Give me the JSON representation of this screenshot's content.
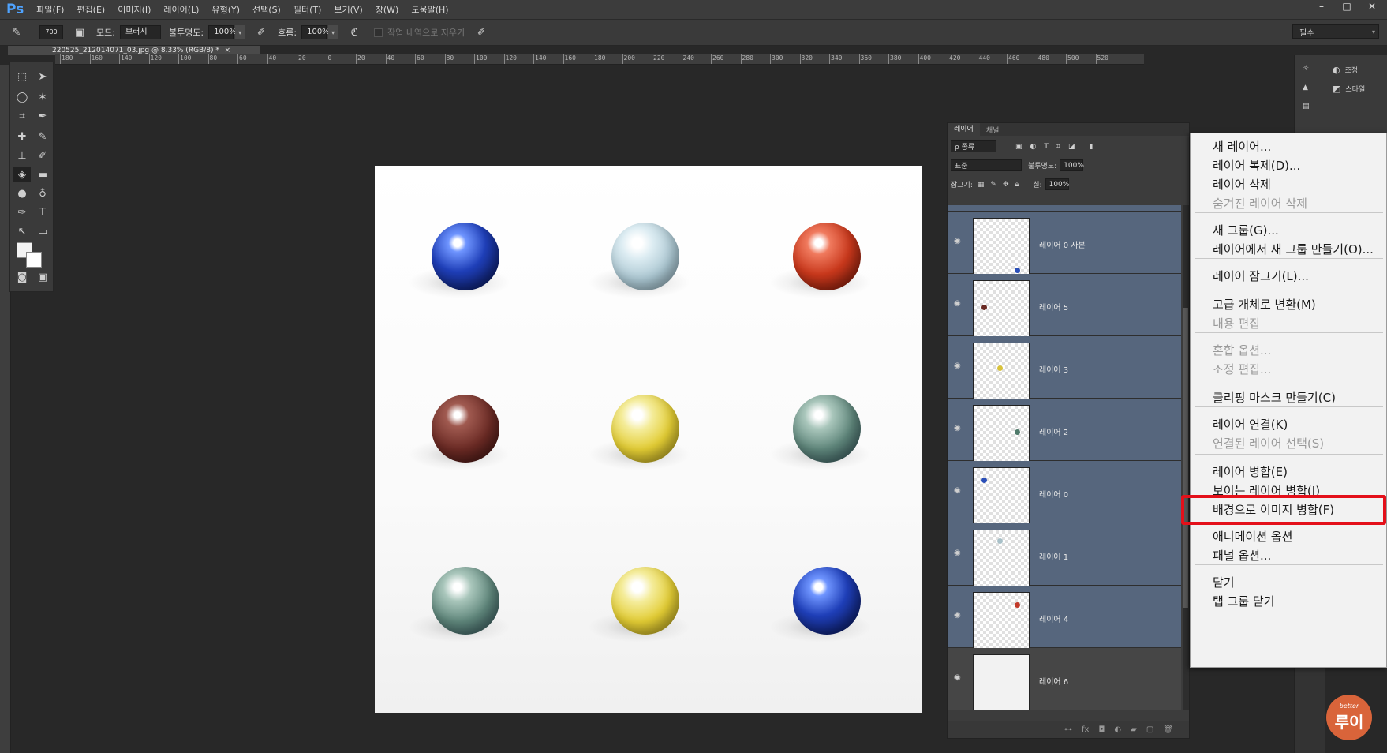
{
  "app": {
    "logo": "Ps"
  },
  "menubar": {
    "items": [
      "파일(F)",
      "편집(E)",
      "이미지(I)",
      "레이어(L)",
      "유형(Y)",
      "선택(S)",
      "필터(T)",
      "보기(V)",
      "창(W)",
      "도움말(H)"
    ],
    "window_buttons": [
      "–",
      "□",
      "✕"
    ]
  },
  "options_bar": {
    "brush_size": "700",
    "mode_label": "모드:",
    "mode_value": "브러시",
    "opacity_label": "불투명도:",
    "opacity_value": "100%",
    "flow_label": "흐름:",
    "flow_value": "100%",
    "erase_history_label": "작업 내역으로 지우기",
    "workspace": "필수"
  },
  "document": {
    "tab_title": "220525_212014071_03.jpg @ 8.33% (RGB/8) *",
    "close": "×"
  },
  "ruler": {
    "labels": [
      "180",
      "160",
      "140",
      "120",
      "100",
      "80",
      "60",
      "40",
      "20",
      "0",
      "20",
      "40",
      "60",
      "80",
      "100",
      "120",
      "140",
      "160",
      "180",
      "200",
      "220",
      "240",
      "260",
      "280",
      "300",
      "320",
      "340",
      "360",
      "380",
      "400",
      "420",
      "440",
      "460",
      "480",
      "500",
      "520"
    ]
  },
  "right_dock": {
    "items": [
      {
        "icon": "adjust-icon",
        "label": "조정"
      },
      {
        "icon": "style-icon",
        "label": "스타일"
      }
    ]
  },
  "layers_panel": {
    "tabs": [
      "레이어",
      "채널"
    ],
    "filter_label": "ρ 종류",
    "blend_mode": "표준",
    "opacity_label": "불투명도:",
    "opacity_value": "100%",
    "lock_label": "잠그기:",
    "fill_label": "칠:",
    "fill_value": "100%",
    "layers": [
      {
        "name": "레이어 0 사본",
        "selected": true,
        "dot_color": "#2a4fb8"
      },
      {
        "name": "레이어 5",
        "selected": true,
        "dot_color": "#6a2a24"
      },
      {
        "name": "레이어 3",
        "selected": true,
        "dot_color": "#d8c23a"
      },
      {
        "name": "레이어 2",
        "selected": true,
        "dot_color": "#4f7a6a"
      },
      {
        "name": "레이어 0",
        "selected": true,
        "dot_color": "#2a4fb8"
      },
      {
        "name": "레이어 1",
        "selected": true,
        "dot_color": "#a8c0c8"
      },
      {
        "name": "레이어 4",
        "selected": true,
        "dot_color": "#c23a2a"
      },
      {
        "name": "레이어 6",
        "selected": false,
        "dot_color": ""
      }
    ]
  },
  "context_menu": {
    "items": [
      {
        "label": "새 레이어...",
        "disabled": false
      },
      {
        "label": "레이어 복제(D)...",
        "disabled": false
      },
      {
        "label": "레이어 삭제",
        "disabled": false
      },
      {
        "label": "숨겨진 레이어 삭제",
        "disabled": true
      },
      {
        "label": "새 그룹(G)...",
        "disabled": false
      },
      {
        "label": "레이어에서 새 그룹 만들기(O)...",
        "disabled": false
      },
      {
        "label": "레이어 잠그기(L)...",
        "disabled": false
      },
      {
        "label": "고급 개체로 변환(M)",
        "disabled": false
      },
      {
        "label": "내용 편집",
        "disabled": true
      },
      {
        "label": "혼합 옵션...",
        "disabled": true
      },
      {
        "label": "조정 편집...",
        "disabled": true
      },
      {
        "label": "클리핑 마스크 만들기(C)",
        "disabled": false
      },
      {
        "label": "레이어 연결(K)",
        "disabled": false
      },
      {
        "label": "연결된 레이어 선택(S)",
        "disabled": true
      },
      {
        "label": "레이어 병합(E)",
        "disabled": false,
        "highlighted": true
      },
      {
        "label": "보이는 레이어 병합(I)",
        "disabled": false
      },
      {
        "label": "배경으로 이미지 병합(F)",
        "disabled": false
      },
      {
        "label": "애니메이션 옵션",
        "disabled": false
      },
      {
        "label": "패널 옵션...",
        "disabled": false
      },
      {
        "label": "닫기",
        "disabled": false
      },
      {
        "label": "탭 그룹 닫기",
        "disabled": false
      }
    ],
    "highlight_color": "#e4101a"
  },
  "canvas": {
    "marbles": [
      {
        "color": "blue-white swirl"
      },
      {
        "color": "pale aqua speckled"
      },
      {
        "color": "red-white swirl"
      },
      {
        "color": "brown solid"
      },
      {
        "color": "yellow clear"
      },
      {
        "color": "green-blue speckled"
      },
      {
        "color": "green-blue speckled"
      },
      {
        "color": "yellow clear"
      },
      {
        "color": "blue-white swirl"
      }
    ]
  },
  "watermark": {
    "small": "better",
    "main": "루이"
  }
}
